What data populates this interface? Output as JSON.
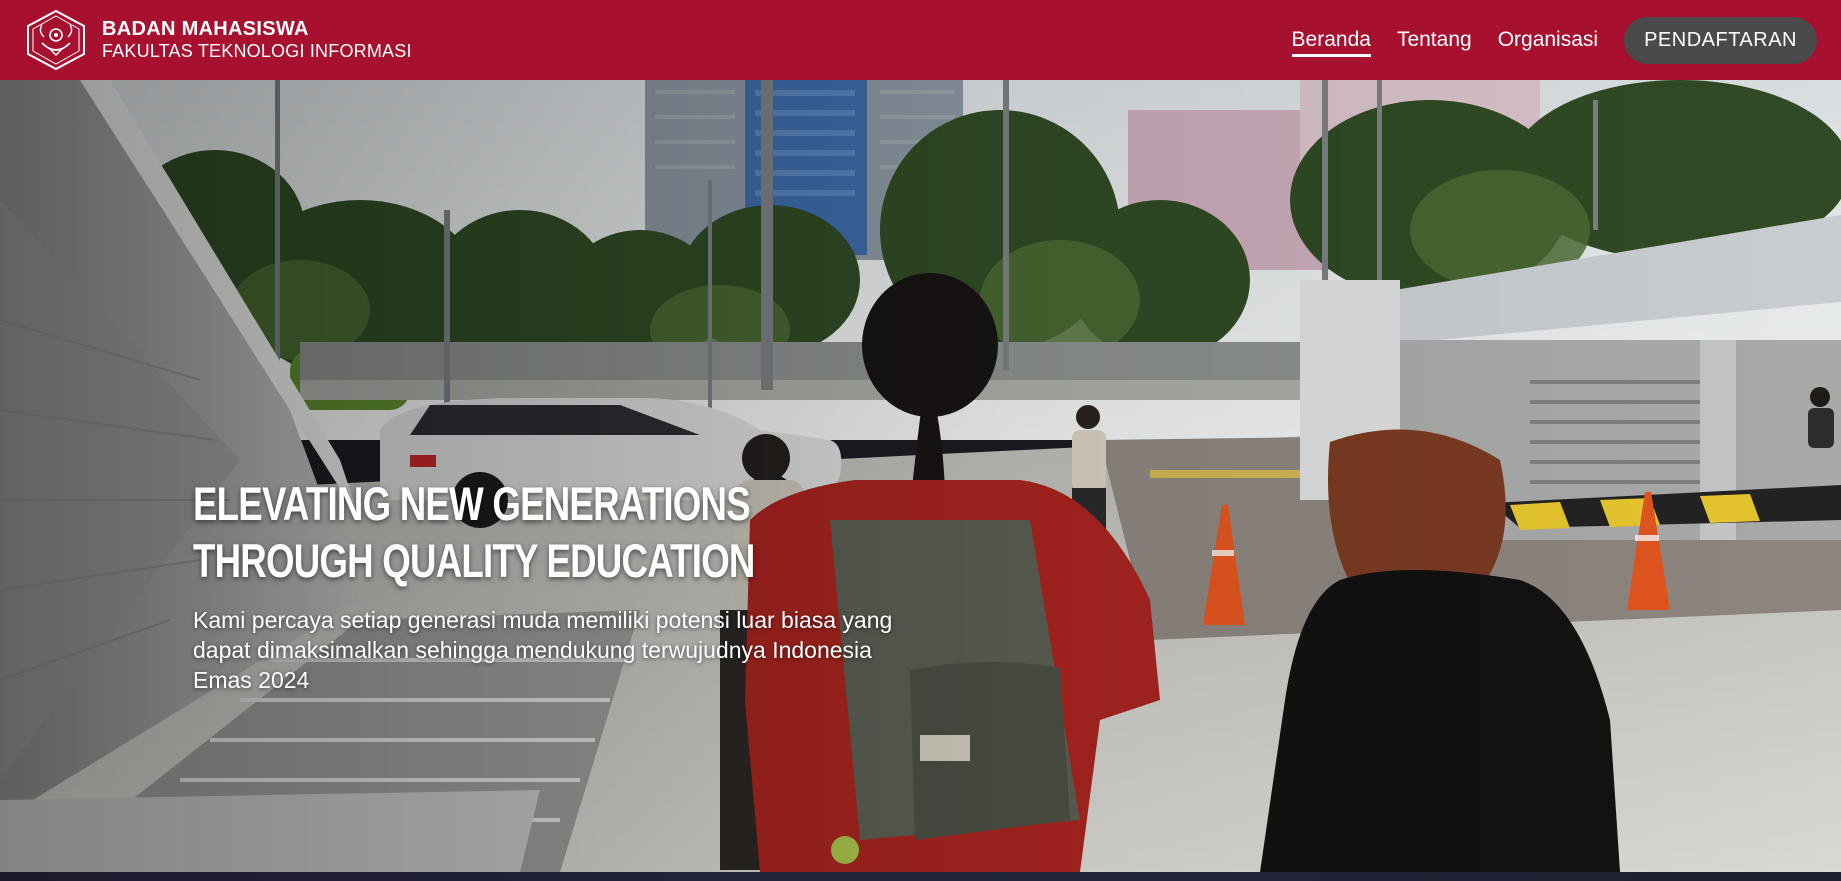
{
  "header": {
    "org_name": "BADAN MAHASISWA",
    "faculty": "FAKULTAS TEKNOLOGI INFORMASI",
    "logo_icon": "university-emblem-icon",
    "brand_color": "#a8102f"
  },
  "nav": {
    "items": [
      {
        "label": "Beranda",
        "active": true
      },
      {
        "label": "Tentang",
        "active": false
      },
      {
        "label": "Organisasi",
        "active": false
      }
    ],
    "cta_label": "PENDAFTARAN",
    "cta_color": "#4a4a4d"
  },
  "hero": {
    "headline_line1": "ELEVATING NEW GENERATIONS",
    "headline_line2": "THROUGH QUALITY EDUCATION",
    "subtext": "Kami percaya setiap generasi muda memiliki potensi luar biasa yang dapat dimaksimalkan sehingga mendukung terwujudnya Indonesia Emas 2024",
    "background": "campus-entrance-photo"
  }
}
